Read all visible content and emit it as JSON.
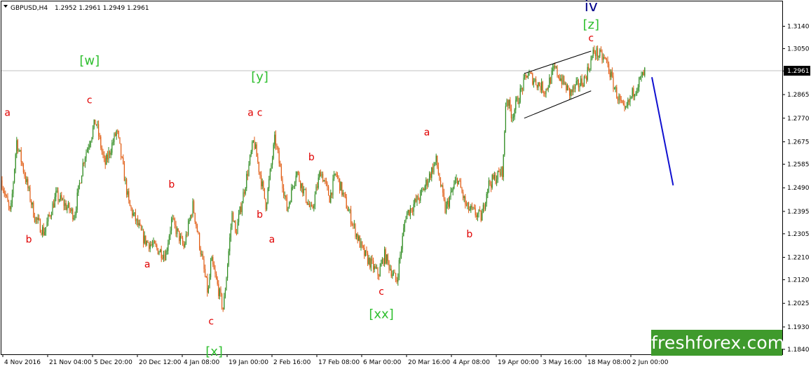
{
  "header": {
    "dropdown_icon": "triangle-down-icon",
    "symbol": "GBPUSD,H4",
    "ohlc": "1.2952 1.2961 1.2949 1.2961"
  },
  "watermark": "freshforex.com",
  "colors": {
    "bull": "#2e8b20",
    "bear": "#e05a10",
    "red_label": "#e00000",
    "green_label": "#2fbf2f",
    "blue_label": "#00008b",
    "forecast": "#1010d0",
    "grid_line": "#c0c0c0",
    "axis": "#000000"
  },
  "chart_data": {
    "type": "candlestick",
    "y_ticks": [
      "1.3140",
      "1.3050",
      "1.2960",
      "1.2865",
      "1.2770",
      "1.2675",
      "1.2585",
      "1.2490",
      "1.2395",
      "1.2305",
      "1.2210",
      "1.2120",
      "1.2025",
      "1.1930",
      "1.1840"
    ],
    "current_price": "1.2961",
    "x_ticks": [
      "4 Nov 2016",
      "21 Nov 04:00",
      "5 Dec 20:00",
      "20 Dec 12:00",
      "4 Jan 08:00",
      "19 Jan 00:00",
      "2 Feb 16:00",
      "17 Feb 08:00",
      "6 Mar 00:00",
      "20 Mar 16:00",
      "4 Apr 08:00",
      "19 Apr 00:00",
      "3 May 16:00",
      "18 May 08:00",
      "2 Jun 00:00"
    ],
    "x_range": [
      "4 Nov 2016",
      "6 Jun 2017"
    ],
    "ylim": [
      1.182,
      1.324
    ],
    "swings": [
      {
        "t": "4 Nov 2016",
        "p": 1.252
      },
      {
        "t": "7 Nov 2016",
        "p": 1.238
      },
      {
        "t": "9 Nov 2016",
        "p": 1.268
      },
      {
        "t": "15 Nov 2016",
        "p": 1.237
      },
      {
        "t": "18 Nov 2016",
        "p": 1.231
      },
      {
        "t": "22 Nov 2016",
        "p": 1.246
      },
      {
        "t": "28 Nov 2016",
        "p": 1.238
      },
      {
        "t": "1 Dec 2016",
        "p": 1.26
      },
      {
        "t": "5 Dec 2016",
        "p": 1.276
      },
      {
        "t": "8 Dec 2016",
        "p": 1.258
      },
      {
        "t": "12 Dec 2016",
        "p": 1.272
      },
      {
        "t": "16 Dec 2016",
        "p": 1.242
      },
      {
        "t": "21 Dec 2016",
        "p": 1.228
      },
      {
        "t": "28 Dec 2016",
        "p": 1.222
      },
      {
        "t": "30 Dec 2016",
        "p": 1.236
      },
      {
        "t": "3 Jan 2017",
        "p": 1.225
      },
      {
        "t": "6 Jan 2017",
        "p": 1.242
      },
      {
        "t": "11 Jan 2017",
        "p": 1.206
      },
      {
        "t": "12 Jan 2017",
        "p": 1.22
      },
      {
        "t": "16 Jan 2017",
        "p": 1.2
      },
      {
        "t": "19 Jan 2017",
        "p": 1.24
      },
      {
        "t": "20 Jan 2017",
        "p": 1.23
      },
      {
        "t": "26 Jan 2017",
        "p": 1.268
      },
      {
        "t": "30 Jan 2017",
        "p": 1.242
      },
      {
        "t": "2 Feb 2017",
        "p": 1.269
      },
      {
        "t": "6 Feb 2017",
        "p": 1.24
      },
      {
        "t": "9 Feb 2017",
        "p": 1.256
      },
      {
        "t": "14 Feb 2017",
        "p": 1.239
      },
      {
        "t": "17 Feb 2017",
        "p": 1.256
      },
      {
        "t": "20 Feb 2017",
        "p": 1.245
      },
      {
        "t": "22 Feb 2017",
        "p": 1.255
      },
      {
        "t": "28 Feb 2017",
        "p": 1.233
      },
      {
        "t": "3 Mar 2017",
        "p": 1.223
      },
      {
        "t": "8 Mar 2017",
        "p": 1.214
      },
      {
        "t": "10 Mar 2017",
        "p": 1.222
      },
      {
        "t": "14 Mar 2017",
        "p": 1.211
      },
      {
        "t": "17 Mar 2017",
        "p": 1.238
      },
      {
        "t": "22 Mar 2017",
        "p": 1.246
      },
      {
        "t": "27 Mar 2017",
        "p": 1.26
      },
      {
        "t": "30 Mar 2017",
        "p": 1.24
      },
      {
        "t": "3 Apr 2017",
        "p": 1.253
      },
      {
        "t": "6 Apr 2017",
        "p": 1.241
      },
      {
        "t": "11 Apr 2017",
        "p": 1.237
      },
      {
        "t": "13 Apr 2017",
        "p": 1.25
      },
      {
        "t": "18 Apr 2017",
        "p": 1.256
      },
      {
        "t": "19 Apr 2017",
        "p": 1.286
      },
      {
        "t": "21 Apr 2017",
        "p": 1.278
      },
      {
        "t": "26 Apr 2017",
        "p": 1.295
      },
      {
        "t": "2 May 2017",
        "p": 1.288
      },
      {
        "t": "5 May 2017",
        "p": 1.297
      },
      {
        "t": "10 May 2017",
        "p": 1.287
      },
      {
        "t": "15 May 2017",
        "p": 1.293
      },
      {
        "t": "18 May 2017",
        "p": 1.304
      },
      {
        "t": "22 May 2017",
        "p": 1.3
      },
      {
        "t": "25 May 2017",
        "p": 1.288
      },
      {
        "t": "28 May 2017",
        "p": 1.279
      },
      {
        "t": "31 May 2017",
        "p": 1.288
      },
      {
        "t": "4 Jun 2017",
        "p": 1.2961
      }
    ],
    "channel": {
      "upper": [
        {
          "t": "25 Apr 2017",
          "p": 1.295
        },
        {
          "t": "17 May 2017",
          "p": 1.304
        }
      ],
      "lower": [
        {
          "t": "25 Apr 2017",
          "p": 1.277
        },
        {
          "t": "17 May 2017",
          "p": 1.288
        }
      ]
    },
    "forecast": [
      {
        "t": "6 Jun 2017",
        "p": 1.2935
      },
      {
        "t": "13 Jun 2017",
        "p": 1.25
      }
    ],
    "wave_labels": [
      {
        "text": "a",
        "color": "red",
        "t": "6 Nov 2016",
        "p": 1.278,
        "size": "small"
      },
      {
        "text": "b",
        "color": "red",
        "t": "13 Nov 2016",
        "p": 1.227,
        "size": "small"
      },
      {
        "text": "c",
        "color": "red",
        "t": "3 Dec 2016",
        "p": 1.283,
        "size": "small"
      },
      {
        "text": "[w]",
        "color": "green",
        "t": "3 Dec 2016",
        "p": 1.2985,
        "size": "medium"
      },
      {
        "text": "a",
        "color": "red",
        "t": "22 Dec 2016",
        "p": 1.217,
        "size": "small"
      },
      {
        "text": "b",
        "color": "red",
        "t": "30 Dec 2016",
        "p": 1.249,
        "size": "small"
      },
      {
        "text": "c",
        "color": "red",
        "t": "12 Jan 2017",
        "p": 1.194,
        "size": "small"
      },
      {
        "text": "[x]",
        "color": "green",
        "t": "13 Jan 2017",
        "p": 1.1815,
        "size": "medium"
      },
      {
        "text": "a",
        "color": "red",
        "t": "25 Jan 2017",
        "p": 1.278,
        "size": "small"
      },
      {
        "text": "[y]",
        "color": "green",
        "t": "28 Jan 2017",
        "p": 1.292,
        "size": "medium"
      },
      {
        "text": "c",
        "color": "red",
        "t": "28 Jan 2017",
        "p": 1.278,
        "size": "small"
      },
      {
        "text": "b",
        "color": "red",
        "t": "28 Jan 2017",
        "p": 1.237,
        "size": "small"
      },
      {
        "text": "a",
        "color": "red",
        "t": "1 Feb 2017",
        "p": 1.227,
        "size": "small"
      },
      {
        "text": "b",
        "color": "red",
        "t": "14 Feb 2017",
        "p": 1.26,
        "size": "small"
      },
      {
        "text": "c",
        "color": "red",
        "t": "9 Mar 2017",
        "p": 1.206,
        "size": "small"
      },
      {
        "text": "[xx]",
        "color": "green",
        "t": "9 Mar 2017",
        "p": 1.1965,
        "size": "medium"
      },
      {
        "text": "a",
        "color": "red",
        "t": "24 Mar 2017",
        "p": 1.27,
        "size": "small"
      },
      {
        "text": "b",
        "color": "red",
        "t": "7 Apr 2017",
        "p": 1.229,
        "size": "small"
      },
      {
        "text": "c",
        "color": "red",
        "t": "17 May 2017",
        "p": 1.308,
        "size": "small"
      },
      {
        "text": "[z]",
        "color": "green",
        "t": "17 May 2017",
        "p": 1.313,
        "size": "medium"
      },
      {
        "text": "iv",
        "color": "blue",
        "t": "17 May 2017",
        "p": 1.32,
        "size": "large"
      }
    ]
  }
}
